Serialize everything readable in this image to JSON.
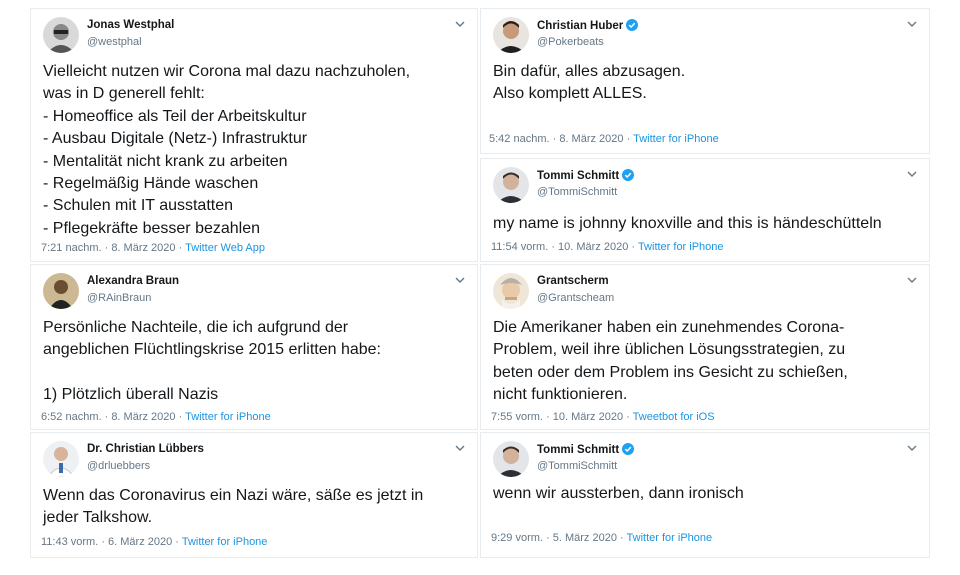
{
  "tweets": [
    {
      "name": "Jonas Westphal",
      "handle": "@westphal",
      "verified": false,
      "text": "Vielleicht nutzen wir Corona mal dazu nachzuholen,\nwas in D generell fehlt:\n- Homeoffice als Teil der Arbeitskultur\n- Ausbau Digitale (Netz-) Infrastruktur\n- Mentalität nicht krank zu arbeiten\n- Regelmäßig Hände waschen\n- Schulen mit IT ausstatten\n- Pflegekräfte besser bezahlen",
      "time": "7:21 nachm. · 8. März 2020 · ",
      "source": "Twitter Web App"
    },
    {
      "name": "Christian Huber",
      "handle": "@Pokerbeats",
      "verified": true,
      "text": "Bin dafür, alles abzusagen.\nAlso komplett ALLES.",
      "time": "5:42 nachm. · 8. März 2020 · ",
      "source": "Twitter for iPhone"
    },
    {
      "name": "Tommi Schmitt",
      "handle": "@TommiSchmitt",
      "verified": true,
      "text": "my name is johnny knoxville and this is händeschütteln",
      "time": "11:54 vorm. · 10. März 2020 · ",
      "source": "Twitter for iPhone"
    },
    {
      "name": "Alexandra Braun",
      "handle": "@RAinBraun",
      "verified": false,
      "text": "Persönliche Nachteile, die ich aufgrund der\nangeblichen Flüchtlingskrise 2015 erlitten habe:\n\n1) Plötzlich überall Nazis",
      "time": "6:52 nachm. · 8. März 2020 · ",
      "source": "Twitter for iPhone"
    },
    {
      "name": "Grantscherm",
      "handle": "@Grantscheam",
      "verified": false,
      "text": "Die Amerikaner haben ein zunehmendes Corona-\nProblem, weil ihre üblichen Lösungsstrategien, zu\nbeten oder dem Problem ins Gesicht zu schießen,\nnicht funktionieren.",
      "time": "7:55 vorm. · 10. März 2020 · ",
      "source": "Tweetbot for iOS"
    },
    {
      "name": "Dr. Christian Lübbers",
      "handle": "@drluebbers",
      "verified": false,
      "text": "Wenn das Coronavirus ein Nazi wäre, säße es jetzt in\njeder Talkshow.",
      "time": "11:43 vorm. · 6. März 2020 · ",
      "source": "Twitter for iPhone"
    },
    {
      "name": "Tommi Schmitt",
      "handle": "@TommiSchmitt",
      "verified": true,
      "text": "wenn wir aussterben, dann ironisch",
      "time": "9:29 vorm. · 5. März 2020 · ",
      "source": "Twitter for iPhone"
    }
  ],
  "colors": {
    "link": "#1b95e0",
    "muted": "#657786",
    "text": "#14171a",
    "verified": "#1da1f2"
  },
  "icons": {
    "chevron": "chevron-down-icon",
    "verified": "verified-badge-icon"
  }
}
